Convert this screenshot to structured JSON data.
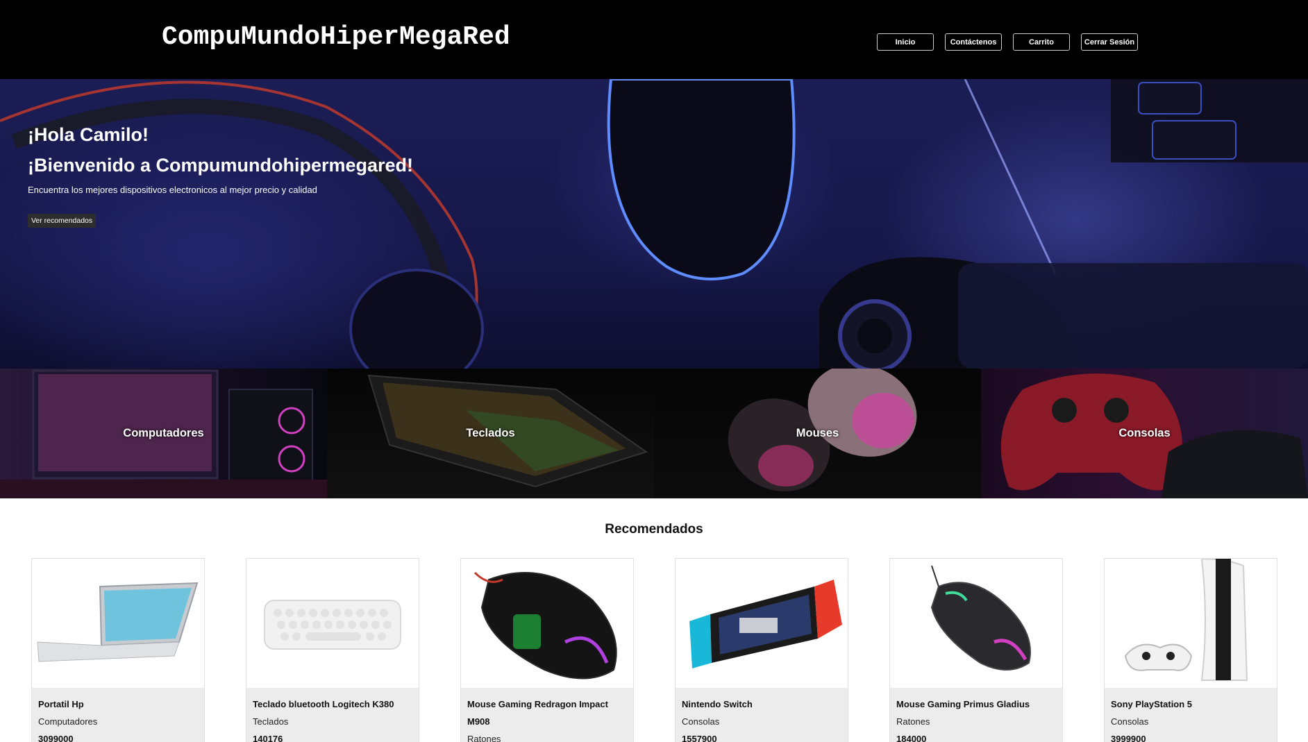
{
  "header": {
    "brand": "CompuMundoHiperMegaRed",
    "nav": [
      "Inicio",
      "Contáctenos",
      "Carrito",
      "Cerrar Sesión"
    ]
  },
  "hero": {
    "greeting": "¡Hola Camilo!",
    "welcome": "¡Bienvenido a Compumundohipermegared!",
    "subtitle": "Encuentra los mejores dispositivos electronicos al mejor precio y calidad",
    "button": "Ver recomendados"
  },
  "categories": [
    "Computadores",
    "Teclados",
    "Mouses",
    "Consolas"
  ],
  "recommended": {
    "title": "Recomendados",
    "products": [
      {
        "name": "Portatil Hp",
        "category": "Computadores",
        "price": "3099000",
        "image_icon": "laptop-icon"
      },
      {
        "name": "Teclado bluetooth Logitech K380",
        "category": "Teclados",
        "price": "140176",
        "image_icon": "keyboard-icon"
      },
      {
        "name": "Mouse Gaming Redragon Impact M908",
        "category": "Ratones",
        "price": "",
        "image_icon": "mouse-icon"
      },
      {
        "name": "Nintendo Switch",
        "category": "Consolas",
        "price": "1557900",
        "image_icon": "console-icon"
      },
      {
        "name": "Mouse Gaming Primus Gladius",
        "category": "Ratones",
        "price": "184000",
        "image_icon": "mouse-icon"
      },
      {
        "name": "Sony PlayStation 5",
        "category": "Consolas",
        "price": "3999900",
        "image_icon": "console-icon"
      }
    ]
  },
  "colors": {
    "header_bg": "#000000",
    "hero_blue": "#1b1d55",
    "card_body": "#ececec"
  }
}
